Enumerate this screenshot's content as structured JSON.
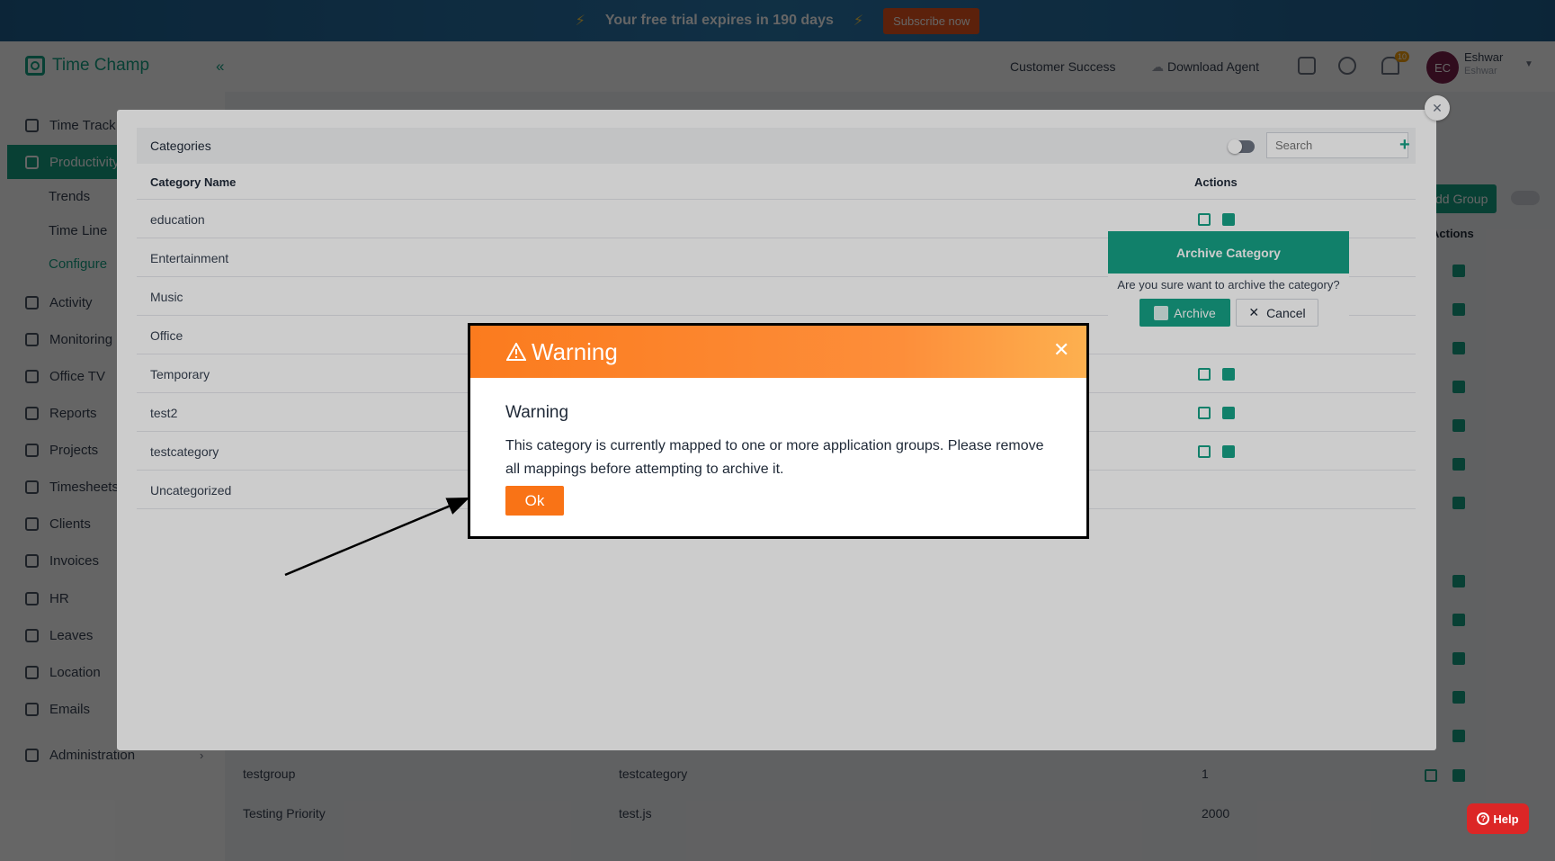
{
  "banner": {
    "trial_text": "Your free trial expires in 190 days",
    "subscribe_label": "Subscribe now"
  },
  "header": {
    "app_name": "Time Champ",
    "collapse_glyph": "«",
    "customer_success": "Customer Success",
    "download_agent": "Download Agent",
    "notification_count": "10",
    "avatar_initials": "EC",
    "user_name": "Eshwar",
    "user_sub": "Eshwar"
  },
  "sidebar": {
    "items": [
      {
        "label": "Time Track"
      },
      {
        "label": "Productivity"
      },
      {
        "label": "Activity"
      },
      {
        "label": "Monitoring"
      },
      {
        "label": "Office TV"
      },
      {
        "label": "Reports"
      },
      {
        "label": "Projects"
      },
      {
        "label": "Timesheets"
      },
      {
        "label": "Clients"
      },
      {
        "label": "Invoices"
      },
      {
        "label": "HR"
      },
      {
        "label": "Leaves"
      },
      {
        "label": "Location"
      },
      {
        "label": "Emails"
      },
      {
        "label": "Administration"
      }
    ],
    "sub_items": [
      {
        "label": "Trends"
      },
      {
        "label": "Time Line"
      },
      {
        "label": "Configure"
      }
    ]
  },
  "background": {
    "add_group_label": "Add Group",
    "actions_header": "Actions",
    "rows": [
      {
        "name": "testgroup",
        "category": "testcategory",
        "count": "1"
      },
      {
        "name": "Testing Priority",
        "category": "test.js",
        "count": "2000"
      }
    ]
  },
  "categories_modal": {
    "title": "Categories",
    "search_placeholder": "Search",
    "col_name": "Category Name",
    "col_actions": "Actions",
    "rows": [
      {
        "name": "education"
      },
      {
        "name": "Entertainment"
      },
      {
        "name": "Music"
      },
      {
        "name": "Office"
      },
      {
        "name": "Temporary"
      },
      {
        "name": "test2"
      },
      {
        "name": "testcategory"
      },
      {
        "name": "Uncategorized"
      }
    ]
  },
  "archive_popover": {
    "title": "Archive Category",
    "question": "Are you sure want to archive the category?",
    "archive_label": "Archive",
    "cancel_label": "Cancel"
  },
  "warning_modal": {
    "title": "Warning",
    "subtitle": "Warning",
    "message": "This category is currently mapped to one or more application groups. Please remove all mappings before attempting to archive it.",
    "ok_label": "Ok"
  },
  "help": {
    "label": "Help"
  },
  "colors": {
    "accent": "#16a085",
    "warning": "#f97316",
    "danger": "#dc2626"
  }
}
